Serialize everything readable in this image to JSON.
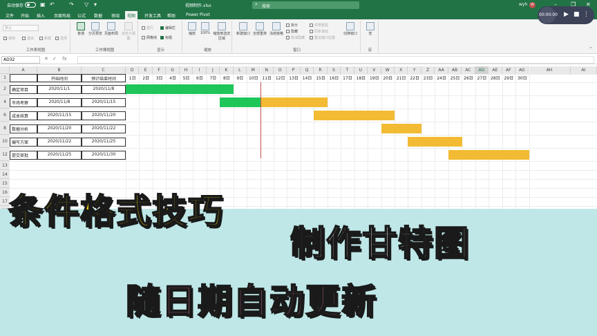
{
  "titlebar": {
    "autosave": "自动保存",
    "filename": "视频制作.xlsx",
    "search_placeholder": "搜索",
    "user": "wyh",
    "avatar": "W",
    "icons": [
      "save-icon",
      "undo-icon",
      "redo-icon",
      "filter-icon",
      "minimize-icon",
      "restore-icon",
      "close-icon"
    ],
    "accent_color": "#217346"
  },
  "ribbon_tabs": [
    "文件",
    "开始",
    "插入",
    "页面布局",
    "公式",
    "数据",
    "审阅",
    "视图",
    "开发工具",
    "帮助",
    "Power Pivot"
  ],
  "active_tab": "视图",
  "ribbon": {
    "sheet_view": {
      "label": "工作表视图",
      "dropdown": "默认",
      "buttons": [
        "保持",
        "退出",
        "新建",
        "选项"
      ]
    },
    "workbook_views": {
      "label": "工作簿视图",
      "buttons": [
        "普通",
        "分页预览",
        "页面布局",
        "自定义视图"
      ]
    },
    "show": {
      "label": "显示",
      "checks": [
        {
          "label": "直尺",
          "checked": false,
          "enabled": false
        },
        {
          "label": "编辑栏",
          "checked": true,
          "enabled": true
        },
        {
          "label": "网格线",
          "checked": false,
          "enabled": true
        },
        {
          "label": "标题",
          "checked": true,
          "enabled": true
        }
      ]
    },
    "zoom": {
      "label": "缩放",
      "buttons": [
        "缩放",
        "100%",
        "缩放到选定区域"
      ]
    },
    "window": {
      "label": "窗口",
      "buttons": [
        "新建窗口",
        "全部重排",
        "冻结窗格"
      ],
      "small": [
        "拆分",
        "隐藏",
        "取消隐藏",
        "并排查看",
        "同步滚动",
        "重设窗口位置"
      ],
      "switch": "切换窗口"
    },
    "macro": {
      "label": "宏",
      "button": "宏"
    }
  },
  "formula_bar": {
    "name_box": "AD32",
    "fx": "fx",
    "value": ""
  },
  "columns": {
    "headers": [
      "A",
      "B",
      "C",
      "D",
      "E",
      "F",
      "G",
      "H",
      "I",
      "J",
      "K",
      "L",
      "M",
      "N",
      "O",
      "P",
      "Q",
      "R",
      "S",
      "T",
      "U",
      "V",
      "W",
      "X",
      "Y",
      "Z",
      "AA",
      "AB",
      "AC",
      "AD",
      "AE",
      "AF",
      "AG",
      "AH",
      "AI"
    ],
    "selected": "AD"
  },
  "rows": {
    "headers": [
      "1",
      "2",
      "4",
      "6",
      "8",
      "10",
      "12",
      "13",
      "14",
      "15",
      "16",
      "17",
      "18",
      "19"
    ],
    "selected": "32"
  },
  "table": {
    "header": [
      "",
      "开始时间",
      "预计结束时间"
    ],
    "rows": [
      {
        "task": "确定项目",
        "start": "2020/11/1",
        "end": "2020/11/8"
      },
      {
        "task": "市场考察",
        "start": "2020/11/8",
        "end": "2020/11/15"
      },
      {
        "task": "成本核算",
        "start": "2020/11/15",
        "end": "2020/11/20"
      },
      {
        "task": "数据分析",
        "start": "2020/11/20",
        "end": "2020/11/22"
      },
      {
        "task": "编写方案",
        "start": "2020/11/22",
        "end": "2020/11/25"
      },
      {
        "task": "提交审批",
        "start": "2020/11/25",
        "end": "2020/11/30"
      }
    ]
  },
  "days": [
    "1日",
    "2日",
    "3日",
    "4日",
    "5日",
    "6日",
    "7日",
    "8日",
    "9日",
    "10日",
    "11日",
    "12日",
    "13日",
    "14日",
    "15日",
    "16日",
    "17日",
    "18日",
    "19日",
    "20日",
    "21日",
    "22日",
    "23日",
    "24日",
    "25日",
    "26日",
    "27日",
    "28日",
    "29日",
    "30日"
  ],
  "gantt": {
    "today_day": 10,
    "done_color": "#1ec65a",
    "pending_color": "#f2bb33",
    "today_line_color": "#c0504d"
  },
  "overlay": {
    "title1": "条件格式技巧",
    "title2": "制作甘特图",
    "title3": "随日期自动更新"
  },
  "recorder": {
    "time": "00:00:00",
    "play_icon": "play-icon",
    "stop_icon": "stop-icon",
    "more_icon": "more-icon"
  }
}
